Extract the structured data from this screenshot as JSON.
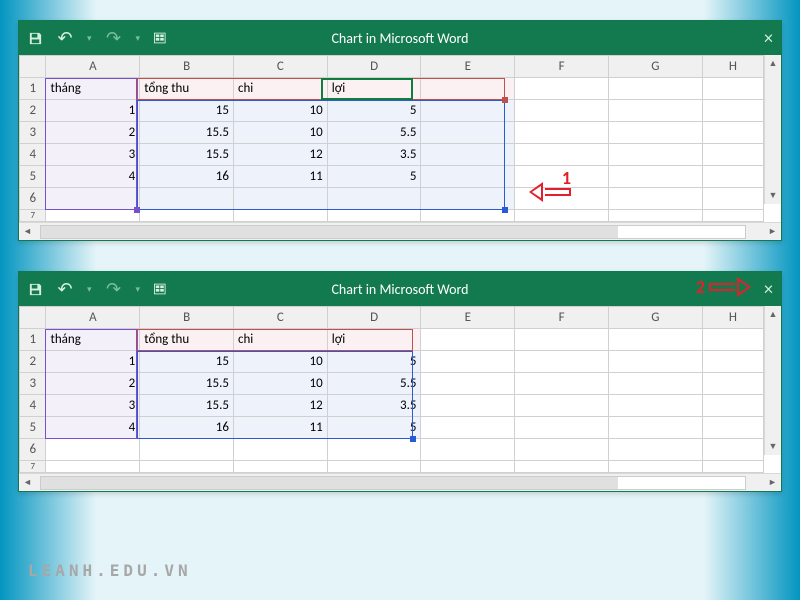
{
  "window_title": "Chart in Microsoft Word",
  "columns": [
    "A",
    "B",
    "C",
    "D",
    "E",
    "F",
    "G",
    "H"
  ],
  "rows_top": [
    "1",
    "2",
    "3",
    "4",
    "5",
    "6",
    "7"
  ],
  "rows_bottom": [
    "1",
    "2",
    "3",
    "4",
    "5",
    "6",
    "7"
  ],
  "head": {
    "A": "tháng",
    "B": "tổng thu",
    "C": "chi",
    "D": "lợi"
  },
  "data": [
    {
      "A": "1",
      "B": "15",
      "C": "10",
      "D": "5"
    },
    {
      "A": "2",
      "B": "15.5",
      "C": "10",
      "D": "5.5"
    },
    {
      "A": "3",
      "B": "15.5",
      "C": "12",
      "D": "3.5"
    },
    {
      "A": "4",
      "B": "16",
      "C": "11",
      "D": "5"
    }
  ],
  "annotations": {
    "arrow1": "1",
    "arrow2": "2"
  },
  "watermark": "LEANH.EDU.VN",
  "chart_data": {
    "type": "table",
    "title": "Chart in Microsoft Word",
    "columns": [
      "tháng",
      "tổng thu",
      "chi",
      "lợi"
    ],
    "rows": [
      [
        1,
        15,
        10,
        5
      ],
      [
        2,
        15.5,
        10,
        5.5
      ],
      [
        3,
        15.5,
        12,
        3.5
      ],
      [
        4,
        16,
        11,
        5
      ]
    ]
  }
}
